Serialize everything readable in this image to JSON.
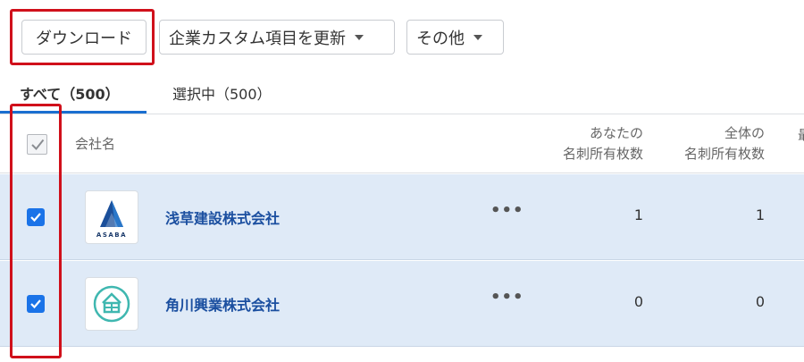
{
  "toolbar": {
    "download_label": "ダウンロード",
    "update_label": "企業カスタム項目を更新",
    "other_label": "その他"
  },
  "tabs": [
    {
      "label": "すべて（500）",
      "active": true
    },
    {
      "label": "選択中（500）",
      "active": false
    }
  ],
  "table": {
    "columns": {
      "company": "会社名",
      "your_cards_line1": "あなたの",
      "your_cards_line2": "名刺所有枚数",
      "all_cards_line1": "全体の",
      "all_cards_line2": "名刺所有枚数",
      "next": "最"
    },
    "rows": [
      {
        "name": "浅草建設株式会社",
        "logo": "asaba-logo",
        "logo_text": "ASABA",
        "menu": "•••",
        "your_cards": "1",
        "all_cards": "1",
        "checked": true
      },
      {
        "name": "角川興業株式会社",
        "logo": "kadokawa-logo",
        "menu": "•••",
        "your_cards": "0",
        "all_cards": "0",
        "checked": true
      }
    ]
  },
  "colors": {
    "accent": "#1a73e8",
    "link": "#1b4fa0",
    "selected_row": "#dfeaf7",
    "highlight": "#d0101b"
  }
}
